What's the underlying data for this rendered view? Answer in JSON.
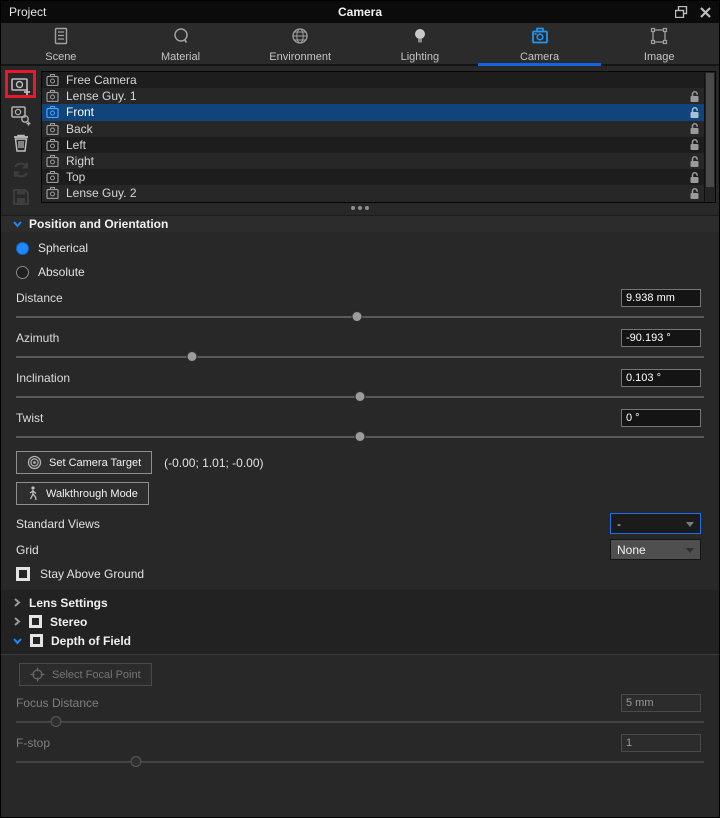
{
  "colors": {
    "accent_blue": "#1e88ff",
    "tab_underline": "#1565e0",
    "selection_blue": "#10457c",
    "annotation_red": "#e8192c",
    "panel_bg": "#282828",
    "list_bg": "#1d1d1d"
  },
  "titlebar": {
    "left_title": "Project",
    "center_title": "Camera"
  },
  "tabs": [
    {
      "label": "Scene"
    },
    {
      "label": "Material"
    },
    {
      "label": "Environment"
    },
    {
      "label": "Lighting"
    },
    {
      "label": "Camera"
    },
    {
      "label": "Image"
    }
  ],
  "camera_list": {
    "items": [
      {
        "name": "Free Camera"
      },
      {
        "name": "Lense Guy. 1"
      },
      {
        "name": "Front"
      },
      {
        "name": "Back"
      },
      {
        "name": "Left"
      },
      {
        "name": "Right"
      },
      {
        "name": "Top"
      },
      {
        "name": "Lense Guy. 2"
      }
    ]
  },
  "position_section": {
    "title": "Position and Orientation",
    "radio_spherical": "Spherical",
    "radio_absolute": "Absolute",
    "sliders": [
      {
        "label": "Distance",
        "value": "9.938 mm",
        "pos": "49.5%"
      },
      {
        "label": "Azimuth",
        "value": "-90.193 °",
        "pos": "25.6%"
      },
      {
        "label": "Inclination",
        "value": "0.103 °",
        "pos": "50%"
      },
      {
        "label": "Twist",
        "value": "0 °",
        "pos": "50%"
      }
    ],
    "set_camera_target_label": "Set Camera Target",
    "target_coords": "(-0.00; 1.01; -0.00)",
    "walkthrough_label": "Walkthrough Mode",
    "standard_views_label": "Standard Views",
    "standard_views_value": "-",
    "grid_label": "Grid",
    "grid_value": "None",
    "stay_above_ground_label": "Stay Above Ground"
  },
  "collapse_sections": {
    "lens_settings": "Lens Settings",
    "stereo": "Stereo",
    "depth_of_field": "Depth of Field"
  },
  "dof": {
    "select_focal_point_label": "Select Focal Point",
    "sliders": [
      {
        "label": "Focus Distance",
        "value": "5 mm",
        "pos": "5.8%"
      },
      {
        "label": "F-stop",
        "value": "1",
        "pos": "17.4%"
      }
    ]
  }
}
